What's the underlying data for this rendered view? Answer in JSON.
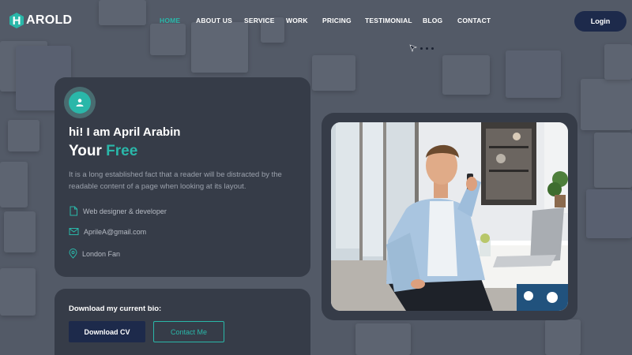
{
  "brand": {
    "mark_letter": "H",
    "name": "AROLD"
  },
  "nav": {
    "items": [
      {
        "label": "HOME",
        "active": true
      },
      {
        "label": "ABOUT US",
        "active": false
      },
      {
        "label": "SERVICE",
        "active": false
      },
      {
        "label": "WORK",
        "active": false
      },
      {
        "label": "PRICING",
        "active": false
      },
      {
        "label": "TESTIMONIAL",
        "active": false
      },
      {
        "label": "BLOG",
        "active": false
      },
      {
        "label": "CONTACT",
        "active": false
      }
    ],
    "login_label": "Login"
  },
  "profile": {
    "greeting": "hi! I am April Arabin",
    "headline_prefix": "Your",
    "headline_accent": "Free",
    "description": "It is a long established fact that a reader will be distracted by the readable content of a page when looking at its layout.",
    "details": [
      {
        "icon": "document-icon",
        "text": "Web designer & developer"
      },
      {
        "icon": "mail-icon",
        "text": "AprileA@gmail.com"
      },
      {
        "icon": "location-pin-icon",
        "text": "London Fan"
      }
    ]
  },
  "bio": {
    "title": "Download my current bio:",
    "download_label": "Download CV",
    "contact_label": "Contact Me"
  },
  "colors": {
    "accent": "#2ab7a9",
    "navy": "#1d2a4b",
    "card": "#363c48",
    "background": "#535a67"
  }
}
